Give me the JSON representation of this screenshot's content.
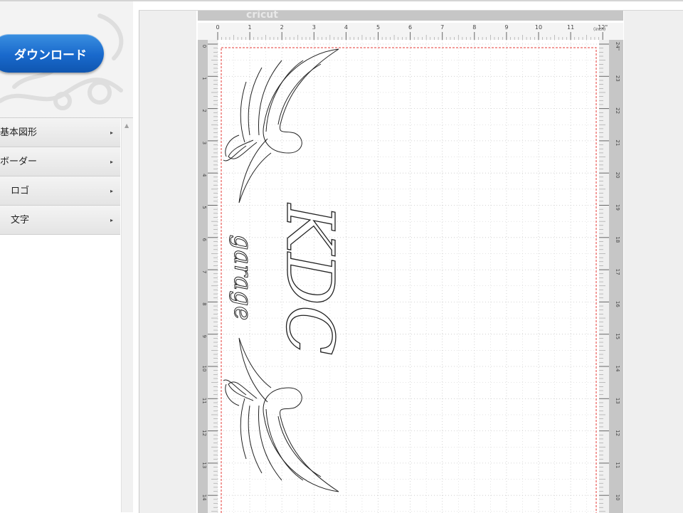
{
  "sidebar": {
    "download_label": "ダウンロード",
    "menu": [
      {
        "label": "基本図形",
        "arrow": "▸"
      },
      {
        "label": "ボーダー",
        "arrow": "▸"
      },
      {
        "label": "ロゴ",
        "arrow": "▸"
      },
      {
        "label": "文字",
        "arrow": "▸"
      }
    ],
    "scroll_up": "▲"
  },
  "mat": {
    "top_label": "cricut",
    "top_units": [
      "0",
      "1",
      "2",
      "3",
      "4",
      "5",
      "6",
      "7",
      "8",
      "9",
      "10",
      "11",
      "12\""
    ],
    "unit_label": "(inch)",
    "left_units": [
      "0",
      "1",
      "2",
      "3",
      "4",
      "5",
      "6",
      "7",
      "8",
      "9",
      "10",
      "11",
      "12",
      "13",
      "14"
    ],
    "right_units": [
      "24\"",
      "23",
      "22",
      "21",
      "20",
      "19",
      "18",
      "17",
      "16",
      "15",
      "14",
      "13",
      "12",
      "11",
      "10"
    ],
    "design": {
      "word_main": "KDC",
      "word_sub": "garage"
    },
    "colors": {
      "mat": "#c6c6c6",
      "grid": "#c8c8c8",
      "cut_line": "#e53935",
      "accent": "#1969cc"
    }
  }
}
